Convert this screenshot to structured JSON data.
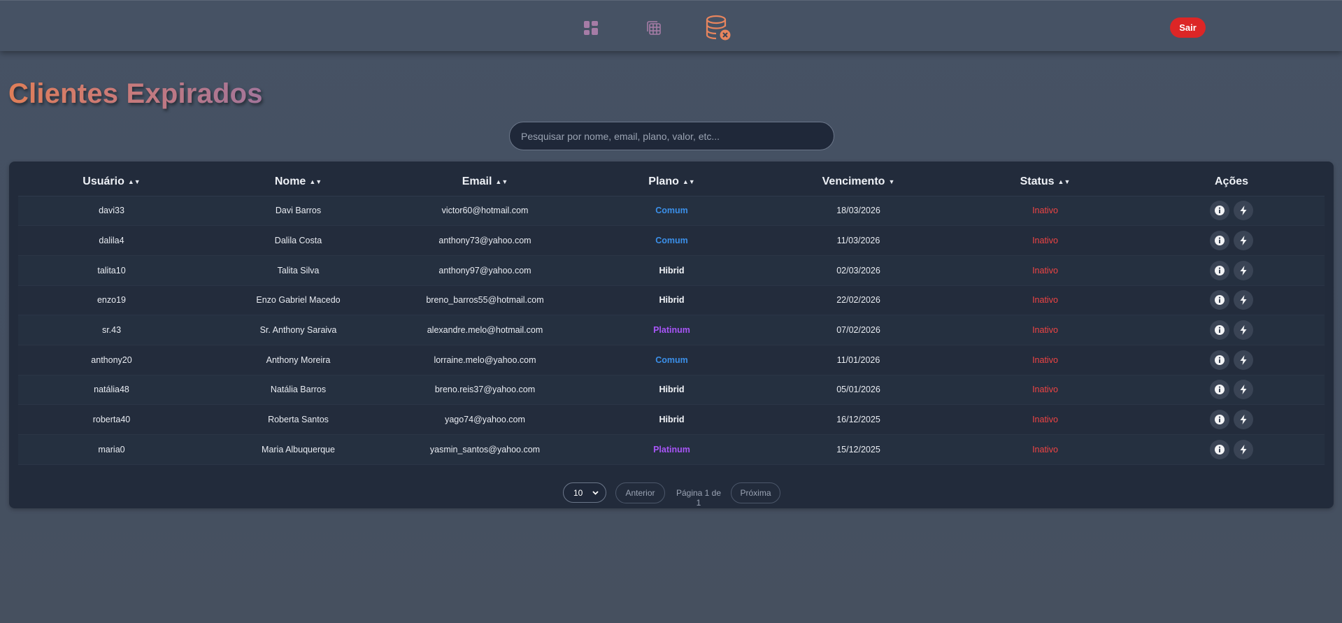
{
  "nav": {
    "icons": [
      "dashboard-icon",
      "table-icon",
      "database-expired-icon"
    ],
    "logout_label": "Sair"
  },
  "page": {
    "title": "Clientes Expirados"
  },
  "search": {
    "placeholder": "Pesquisar por nome, email, plano, valor, etc..."
  },
  "table": {
    "columns": [
      {
        "label": "Usuário",
        "sort": "both"
      },
      {
        "label": "Nome",
        "sort": "both"
      },
      {
        "label": "Email",
        "sort": "both"
      },
      {
        "label": "Plano",
        "sort": "both"
      },
      {
        "label": "Vencimento",
        "sort": "desc"
      },
      {
        "label": "Status",
        "sort": "both"
      },
      {
        "label": "Ações",
        "sort": "none"
      }
    ],
    "rows": [
      {
        "user": "davi33",
        "name": "Davi Barros",
        "email": "victor60@hotmail.com",
        "plan": "Comum",
        "due": "18/03/2026",
        "status": "Inativo"
      },
      {
        "user": "dalila4",
        "name": "Dalila Costa",
        "email": "anthony73@yahoo.com",
        "plan": "Comum",
        "due": "11/03/2026",
        "status": "Inativo"
      },
      {
        "user": "talita10",
        "name": "Talita Silva",
        "email": "anthony97@yahoo.com",
        "plan": "Hibrid",
        "due": "02/03/2026",
        "status": "Inativo"
      },
      {
        "user": "enzo19",
        "name": "Enzo Gabriel Macedo",
        "email": "breno_barros55@hotmail.com",
        "plan": "Hibrid",
        "due": "22/02/2026",
        "status": "Inativo"
      },
      {
        "user": "sr.43",
        "name": "Sr. Anthony Saraiva",
        "email": "alexandre.melo@hotmail.com",
        "plan": "Platinum",
        "due": "07/02/2026",
        "status": "Inativo"
      },
      {
        "user": "anthony20",
        "name": "Anthony Moreira",
        "email": "lorraine.melo@yahoo.com",
        "plan": "Comum",
        "due": "11/01/2026",
        "status": "Inativo"
      },
      {
        "user": "natália48",
        "name": "Natália Barros",
        "email": "breno.reis37@yahoo.com",
        "plan": "Hibrid",
        "due": "05/01/2026",
        "status": "Inativo"
      },
      {
        "user": "roberta40",
        "name": "Roberta Santos",
        "email": "yago74@yahoo.com",
        "plan": "Hibrid",
        "due": "16/12/2025",
        "status": "Inativo"
      },
      {
        "user": "maria0",
        "name": "Maria Albuquerque",
        "email": "yasmin_santos@yahoo.com",
        "plan": "Platinum",
        "due": "15/12/2025",
        "status": "Inativo"
      }
    ],
    "actions": [
      "info-icon",
      "bolt-icon"
    ]
  },
  "pagination": {
    "page_size": "10",
    "prev_label": "Anterior",
    "page_info": "Página 1 de 1",
    "next_label": "Próxima"
  },
  "colors": {
    "accent_red": "#dc2626",
    "plan_comum": "#3b8fe8",
    "plan_hibrid": "#f2f4f8",
    "plan_platinum": "#a855f7",
    "status_inactive": "#ef4444"
  }
}
